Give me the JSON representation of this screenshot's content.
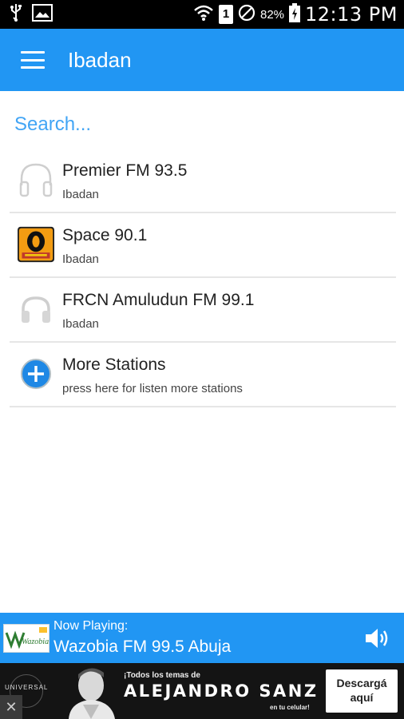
{
  "status_bar": {
    "battery_percent": "82%",
    "time": "12:13 PM",
    "sim_badge": "1",
    "icons": [
      "usb-icon",
      "image-icon",
      "wifi-icon",
      "sim-icon",
      "do-not-disturb-icon",
      "battery-charging-icon"
    ]
  },
  "app_bar": {
    "title": "Ibadan",
    "menu_icon": "hamburger-menu-icon",
    "color": "#2196F3"
  },
  "search": {
    "placeholder": "Search...",
    "value": ""
  },
  "stations": [
    {
      "name": "Premier FM 93.5",
      "location": "Ibadan",
      "icon": "headphones-icon"
    },
    {
      "name": "Space 90.1",
      "location": "Ibadan",
      "icon": "space-logo-icon"
    },
    {
      "name": "FRCN Amuludun FM 99.1",
      "location": "Ibadan",
      "icon": "headphones-icon"
    }
  ],
  "more_stations": {
    "title": "More Stations",
    "subtitle": "press here for listen more stations",
    "icon": "add-circle-icon"
  },
  "now_playing": {
    "label": "Now Playing:",
    "station": "Wazobia FM 99.5 Abuja",
    "logo_text": "Wazobia",
    "volume_icon": "volume-icon"
  },
  "ad": {
    "brand": "UNIVERSAL",
    "headline_small": "¡Todos los temas de",
    "headline_big": "ALEJANDRO SANZ",
    "headline_tiny": "en tu celular!",
    "cta": "Descargá aquí",
    "close": "✕"
  }
}
